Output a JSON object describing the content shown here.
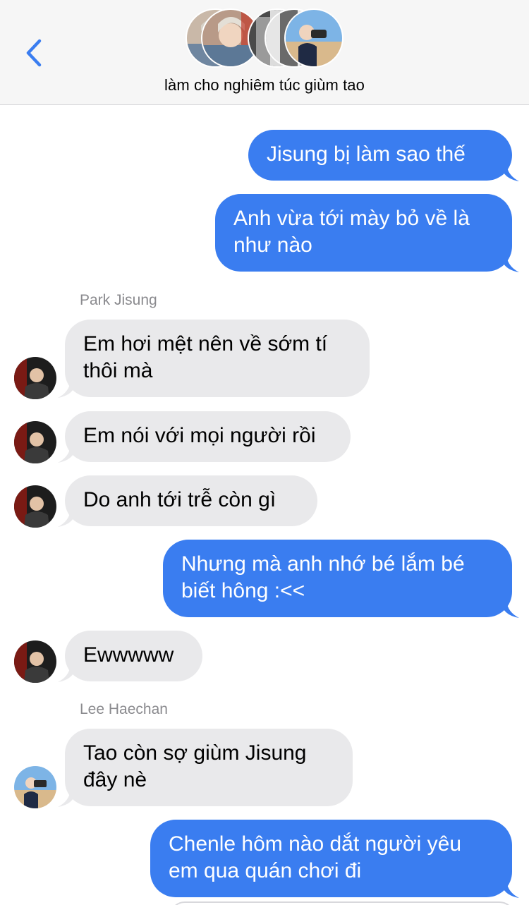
{
  "header": {
    "title": "làm cho nghiêm túc giùm tao",
    "back_icon": "chevron-left-icon",
    "accent_color": "#3a7df0"
  },
  "messages": [
    {
      "direction": "outgoing",
      "text": "Jisung bị làm sao thế"
    },
    {
      "direction": "outgoing",
      "text": "Anh vừa tới mày bỏ về là như nào"
    },
    {
      "direction": "incoming",
      "sender": "Park Jisung",
      "text": "Em hơi mệt nên về sớm tí thôi mà"
    },
    {
      "direction": "incoming",
      "text": "Em nói với mọi người rồi"
    },
    {
      "direction": "incoming",
      "text": "Do anh tới trễ còn gì"
    },
    {
      "direction": "outgoing",
      "text": "Nhưng mà anh nhớ bé lắm bé biết hông :<<"
    },
    {
      "direction": "incoming",
      "text": "Ewwwww"
    },
    {
      "direction": "incoming",
      "sender": "Lee Haechan",
      "text": "Tao còn sợ giùm Jisung đây nè"
    },
    {
      "direction": "outgoing",
      "text": "Chenle hôm nào dắt người yêu em qua quán chơi đi"
    }
  ],
  "colors": {
    "outgoing_bubble": "#3a7df0",
    "incoming_bubble": "#e9e9eb",
    "sender_label": "#8a8a8e"
  }
}
